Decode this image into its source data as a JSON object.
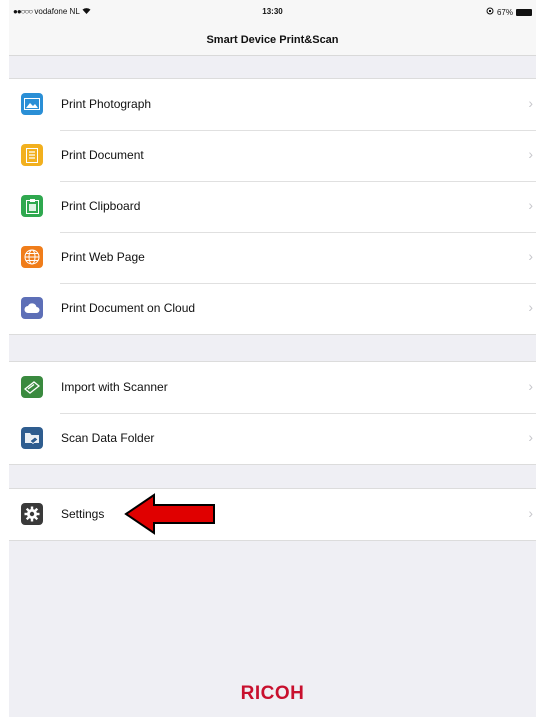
{
  "status_bar": {
    "carrier": "vodafone NL",
    "time": "13:30",
    "battery": "67%"
  },
  "nav": {
    "title": "Smart Device Print&Scan"
  },
  "groups": [
    {
      "items": [
        {
          "label": "Print Photograph",
          "icon": "photo-icon"
        },
        {
          "label": "Print Document",
          "icon": "document-icon"
        },
        {
          "label": "Print Clipboard",
          "icon": "clipboard-icon"
        },
        {
          "label": "Print Web Page",
          "icon": "globe-icon"
        },
        {
          "label": "Print Document on Cloud",
          "icon": "cloud-icon"
        }
      ]
    },
    {
      "items": [
        {
          "label": "Import with Scanner",
          "icon": "scanner-icon"
        },
        {
          "label": "Scan Data Folder",
          "icon": "folder-icon"
        }
      ]
    },
    {
      "items": [
        {
          "label": "Settings",
          "icon": "gear-icon"
        }
      ]
    }
  ],
  "annotation": {
    "arrow_color": "#e00000"
  },
  "footer": {
    "logo": "RICOH",
    "logo_color": "#c8102e"
  }
}
